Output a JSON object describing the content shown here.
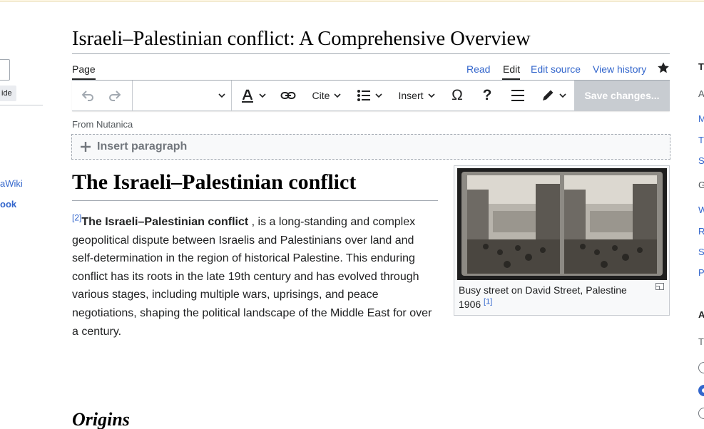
{
  "page": {
    "title": "Israeli–Palestinian conflict: A Comprehensive Overview",
    "from_label": "From Nutanica"
  },
  "left_sidebar": {
    "hide_label": "ide",
    "links": [
      "aWiki",
      "ook"
    ]
  },
  "tabs": {
    "page": "Page",
    "read": "Read",
    "edit": "Edit",
    "edit_source": "Edit source",
    "view_history": "View history",
    "watch_icon": "star-icon"
  },
  "toolbar": {
    "undo_icon": "undo-icon",
    "redo_icon": "redo-icon",
    "format_value": "",
    "cite": "Cite",
    "insert": "Insert",
    "special_char": "Ω",
    "help": "?",
    "save": "Save changes..."
  },
  "editor": {
    "insert_paragraph": "Insert paragraph"
  },
  "article": {
    "heading": "The Israeli–Palestinian conflict",
    "ref_mark": "[2]",
    "lead_bold": "The Israeli–Palestinian conflict",
    "lead_text": " , is a long-standing and complex geopolitical dispute between Israelis and Palestinians over land and self-determination in the region of historical Palestine. This enduring conflict has its roots in the late 19th century and has evolved through various stages, including multiple wars, uprisings, and peace negotiations, shaping the political landscape of the Middle East for over a century.",
    "next_heading": "Origins"
  },
  "figure": {
    "caption": "Busy street on David Street, Palestine 1906",
    "ref_mark": "[1]"
  },
  "right_sidebar": {
    "items": [
      "T",
      "A",
      "M",
      "T",
      "S",
      "G",
      "W",
      "R",
      "S",
      "P",
      "A",
      "T"
    ]
  },
  "colors": {
    "link": "#3366cc",
    "border": "#a2a9b1",
    "save_disabled": "#c8ccd1"
  }
}
